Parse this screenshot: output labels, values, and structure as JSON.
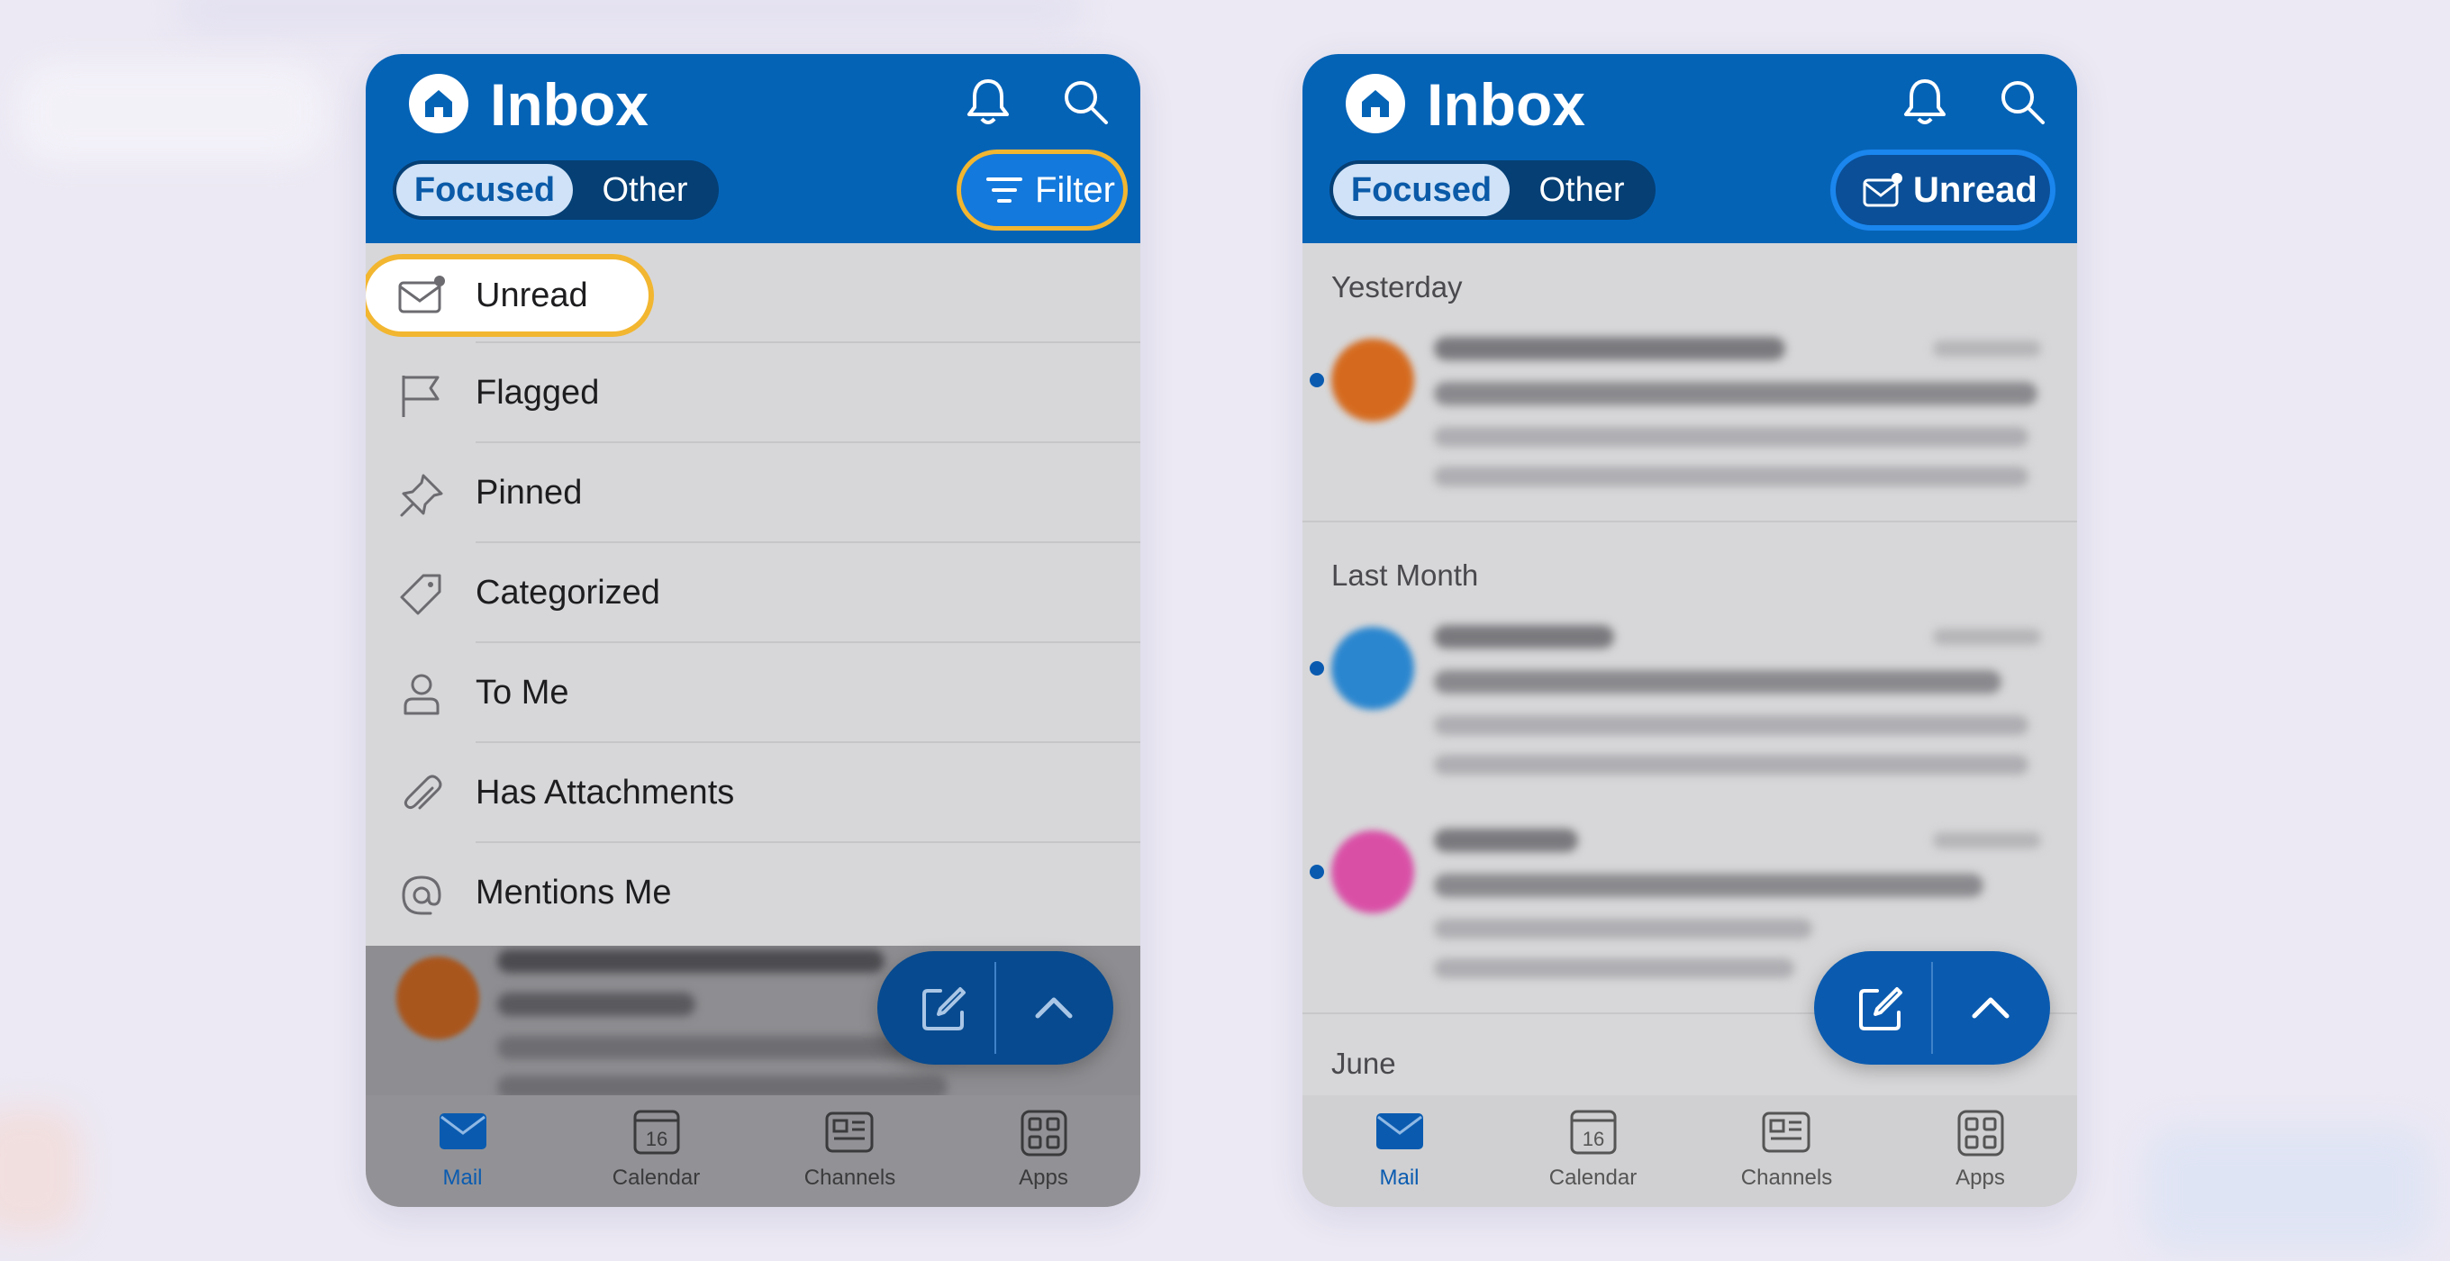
{
  "left_panel": {
    "header": {
      "title": "Inbox",
      "tab_focused": "Focused",
      "tab_other": "Other",
      "filter_label": "Filter"
    },
    "filter_menu": [
      {
        "label": "Unread",
        "icon": "envelope-badge-icon"
      },
      {
        "label": "Flagged",
        "icon": "flag-icon"
      },
      {
        "label": "Pinned",
        "icon": "pin-icon"
      },
      {
        "label": "Categorized",
        "icon": "tag-icon"
      },
      {
        "label": "To Me",
        "icon": "person-icon"
      },
      {
        "label": "Has Attachments",
        "icon": "paperclip-icon"
      },
      {
        "label": "Mentions Me",
        "icon": "at-sign-icon"
      }
    ]
  },
  "right_panel": {
    "header": {
      "title": "Inbox",
      "tab_focused": "Focused",
      "tab_other": "Other",
      "unread_label": "Unread"
    },
    "sections": {
      "yesterday": "Yesterday",
      "last_month": "Last Month",
      "june": "June"
    }
  },
  "bottom_nav": [
    {
      "label": "Mail",
      "icon": "mail-icon"
    },
    {
      "label": "Calendar",
      "icon": "calendar-icon",
      "date": "16"
    },
    {
      "label": "Channels",
      "icon": "channels-icon"
    },
    {
      "label": "Apps",
      "icon": "apps-grid-icon"
    }
  ],
  "colors": {
    "brand_blue": "#0563b6",
    "highlight_yellow": "#f2b630",
    "unread_dot": "#0a5bb0"
  }
}
